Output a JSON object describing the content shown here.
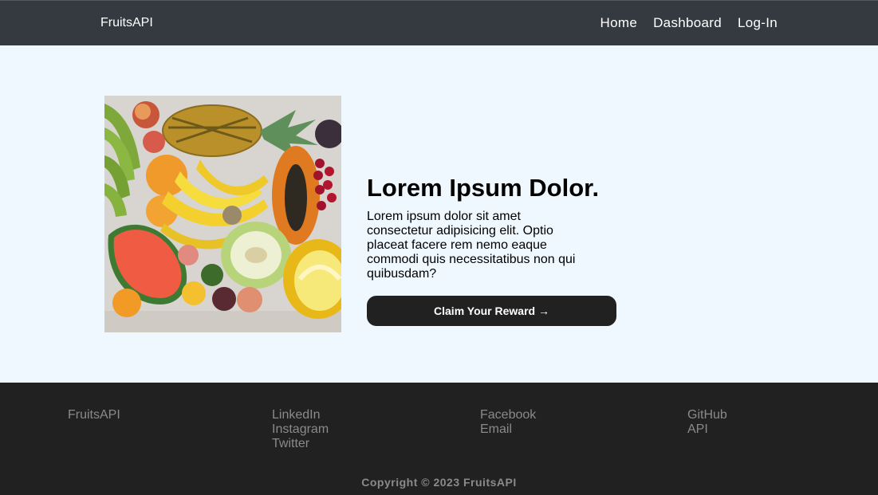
{
  "navbar": {
    "brand": "FruitsAPI",
    "links": [
      "Home",
      "Dashboard",
      "Log-In"
    ]
  },
  "hero": {
    "image_alt": "fruits-image",
    "title": "Lorem Ipsum Dolor.",
    "body": "Lorem ipsum dolor sit amet consectetur adipisicing elit. Optio placeat facere rem nemo eaque commodi quis necessitatibus non qui quibusdam?",
    "cta_label": "Claim Your Reward →"
  },
  "footer": {
    "brand": "FruitsAPI",
    "col2": [
      "LinkedIn",
      "Instagram",
      "Twitter"
    ],
    "col3": [
      "Facebook",
      "Email"
    ],
    "col4": [
      "GitHub",
      "API"
    ],
    "copyright": "Copyright © 2023 FruitsAPI"
  },
  "colors": {
    "navbar_bg": "#343a40",
    "hero_bg": "#f0f8ff",
    "footer_bg": "#212121",
    "button_bg": "#212121"
  }
}
